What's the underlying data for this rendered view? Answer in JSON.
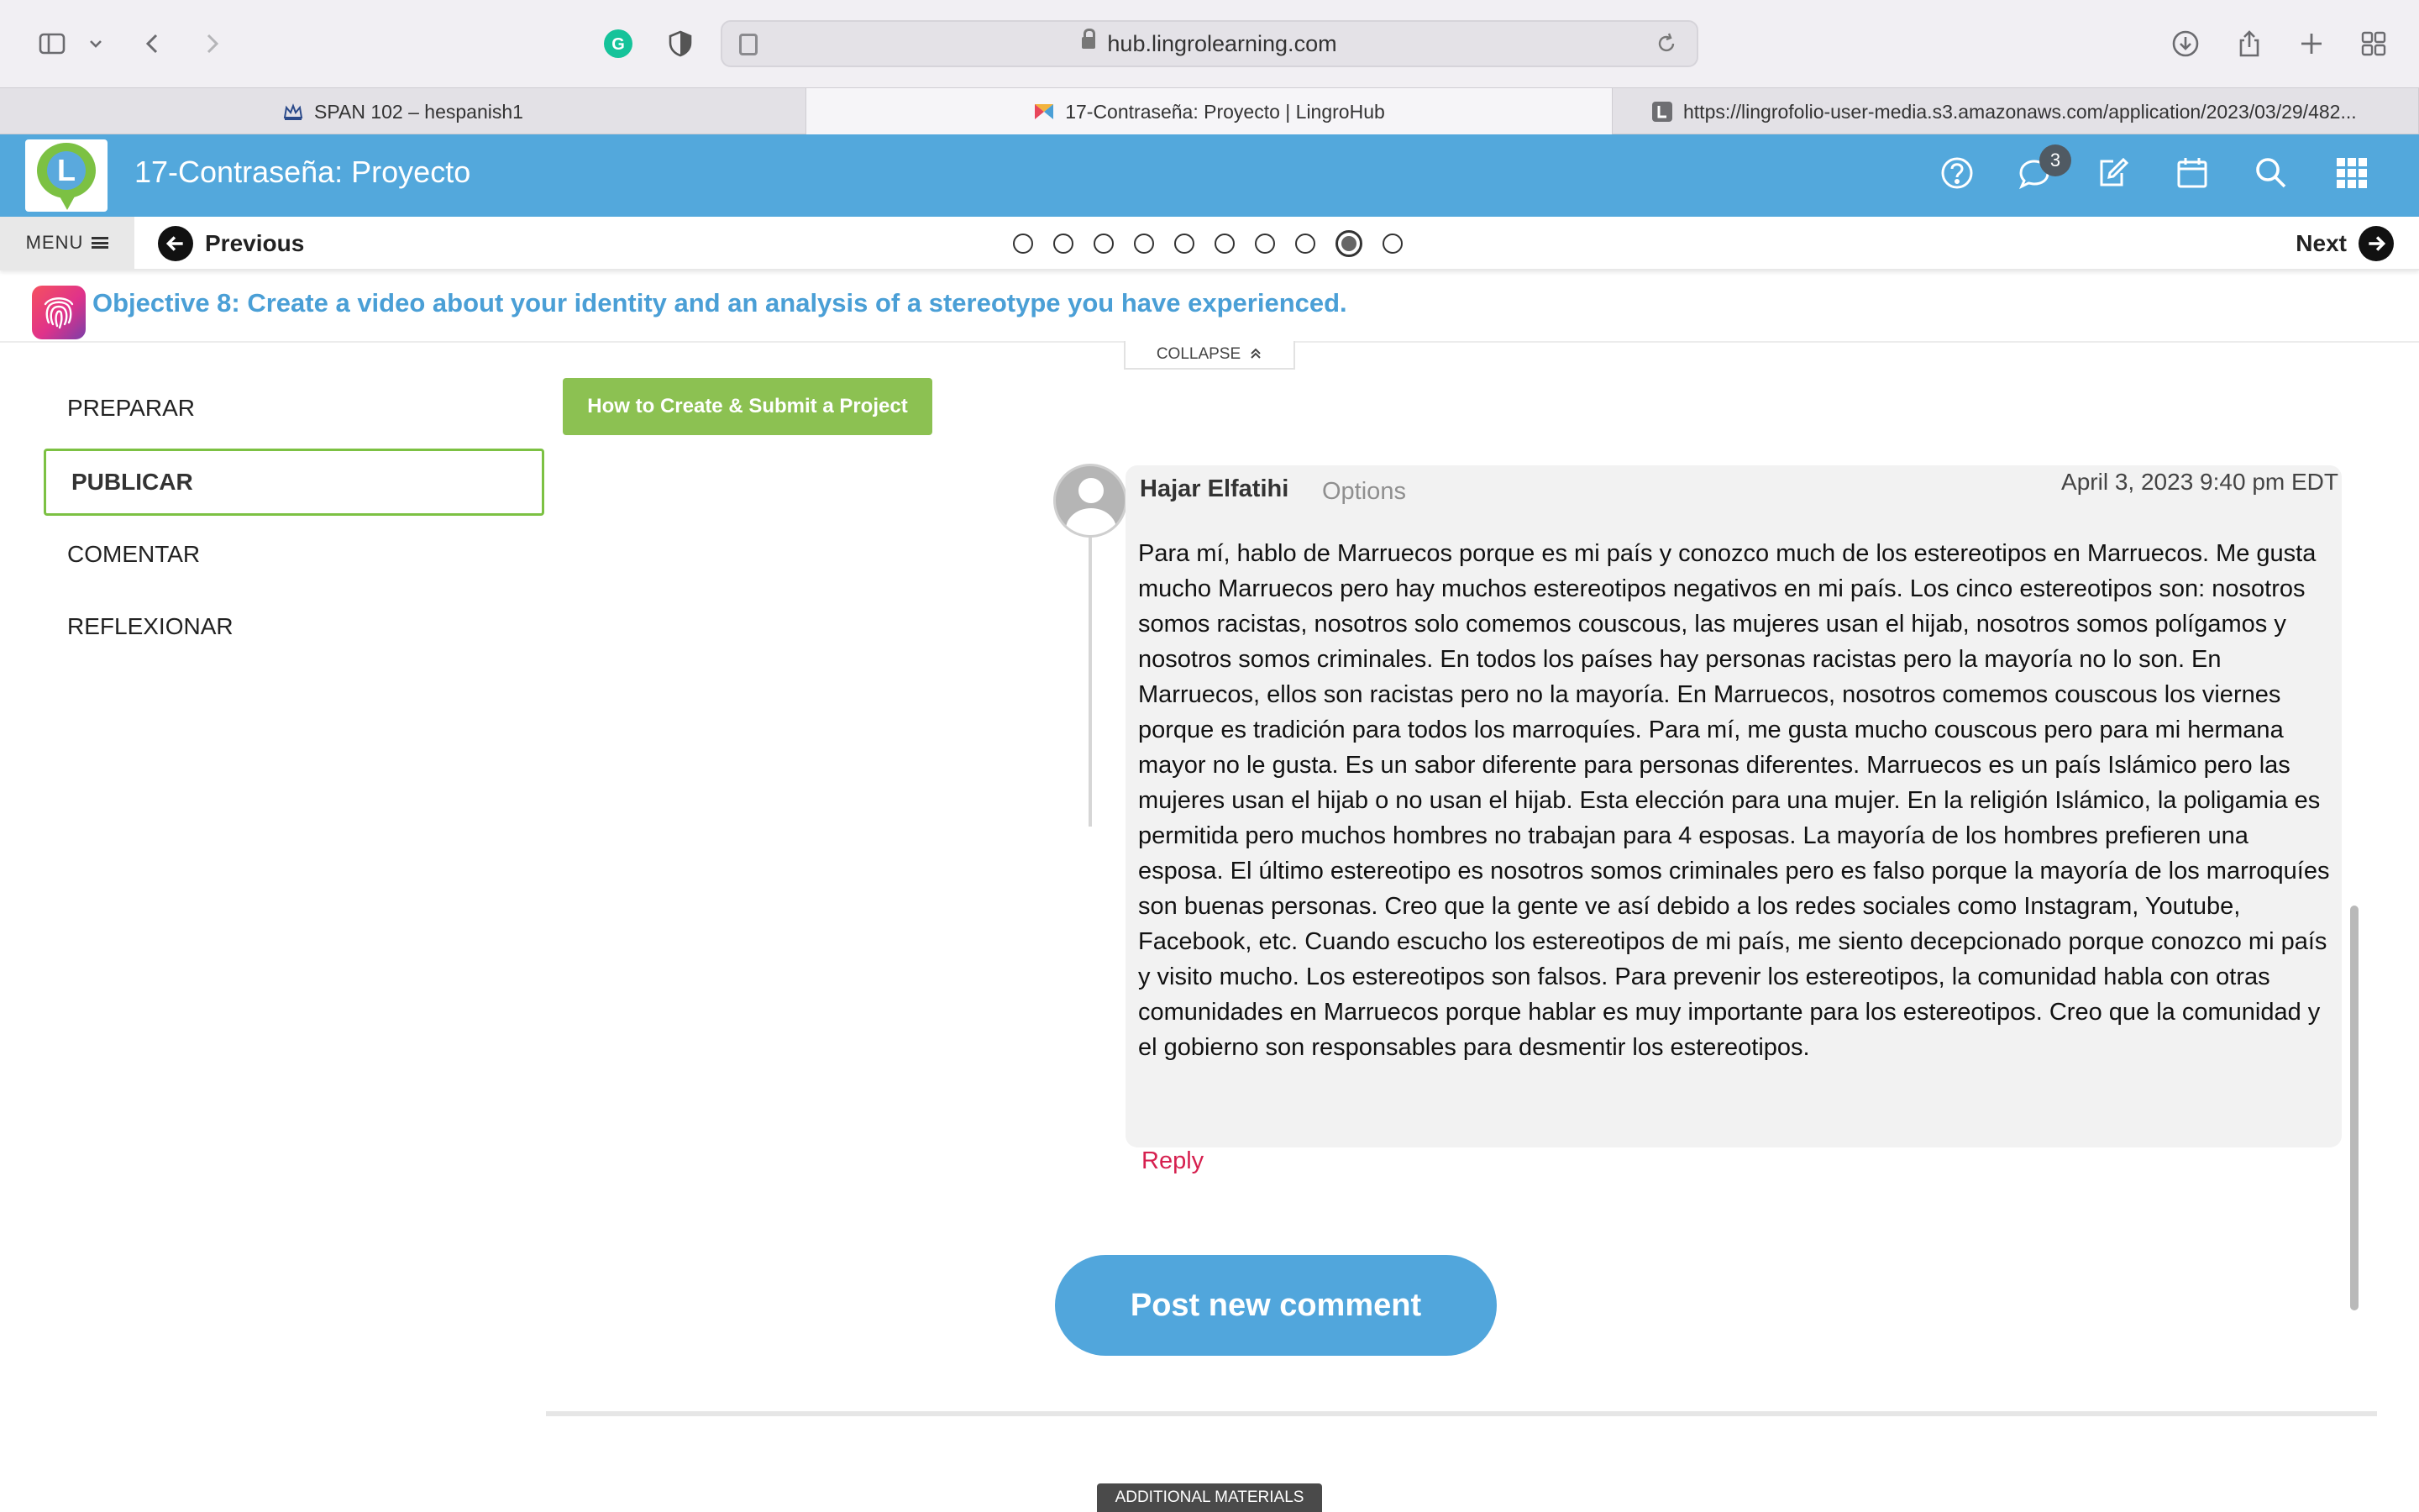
{
  "browser": {
    "url": "hub.lingrolearning.com",
    "tabs": [
      {
        "label": "SPAN 102 – hespanish1"
      },
      {
        "label": "17-Contraseña: Proyecto | LingroHub"
      },
      {
        "label": "https://lingrofolio-user-media.s3.amazonaws.com/application/2023/03/29/482..."
      }
    ],
    "grammarly_icon_letter": "G"
  },
  "header": {
    "logo_letter": "L",
    "title": "17-Contraseña: Proyecto",
    "messages_badge": "3",
    "icons": [
      "help-icon",
      "chat-icon",
      "edit-icon",
      "calendar-icon",
      "search-icon",
      "apps-grid-icon"
    ]
  },
  "nav": {
    "menu_label": "MENU",
    "previous_label": "Previous",
    "next_label": "Next",
    "steps_total": 10,
    "current_step": 9
  },
  "objective": {
    "text": "Objective 8: Create a video about your identity and an analysis of a stereotype you have experienced."
  },
  "collapse_label": "COLLAPSE",
  "sidebar": {
    "items": [
      {
        "label": "PREPARAR"
      },
      {
        "label": "PUBLICAR",
        "active": true
      },
      {
        "label": "COMENTAR"
      },
      {
        "label": "REFLEXIONAR"
      }
    ]
  },
  "howto_button": "How to Create & Submit a Project",
  "comment": {
    "author": "Hajar Elfatihi",
    "options_label": "Options",
    "date": "April 3, 2023 9:40 pm EDT",
    "body": "Para mí, hablo de Marruecos porque es mi país y conozco much de los estereotipos en Marruecos. Me gusta mucho Marruecos pero hay muchos estereotipos negativos en mi país. Los cinco estereotipos  son: nosotros somos racistas, nosotros solo comemos couscous, las mujeres usan el hijab, nosotros somos polígamos y nosotros somos criminales. En todos los países hay personas racistas pero la mayoría no lo son. En Marruecos, ellos son racistas pero no la mayoría. En Marruecos, nosotros comemos couscous los viernes porque es tradición para todos los marroquíes. Para mí, me gusta mucho couscous pero para mi hermana mayor no le gusta. Es un sabor diferente para personas diferentes. Marruecos es un país Islámico pero las mujeres usan el hijab o no usan el hijab. Esta elección para una mujer. En la religión Islámico, la poligamia es permitida pero muchos hombres no trabajan para 4 esposas. La mayoría de los hombres prefieren una esposa. El último estereotipo es nosotros somos criminales pero es falso porque la mayoría de los marroquíes son buenas personas. Creo que la gente ve así debido a los redes sociales como Instagram, Youtube, Facebook, etc. Cuando escucho los estereotipos de mi país, me siento decepcionado porque conozco mi país y visito mucho. Los estereotipos son falsos. Para prevenir los estereotipos, la comunidad habla con otras comunidades en Marruecos porque hablar es muy importante para los estereotipos. Creo que la comunidad y el gobierno son responsables para desmentir los estereotipos.",
    "reply_label": "Reply"
  },
  "post_button": "Post new comment",
  "additional_materials": "ADDITIONAL MATERIALS",
  "colors": {
    "header_blue": "#53a8dc",
    "green": "#8cc152",
    "objective_blue": "#4a9fd6",
    "reply_red": "#d6204f"
  }
}
